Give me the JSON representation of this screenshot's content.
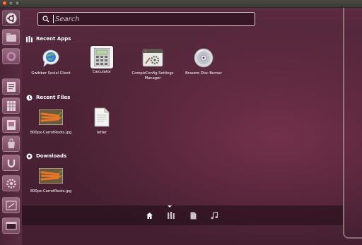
{
  "search": {
    "placeholder": "Search",
    "value": ""
  },
  "sections": {
    "recent_apps": {
      "title": "Recent Apps"
    },
    "recent_files": {
      "title": "Recent Files"
    },
    "downloads": {
      "title": "Downloads"
    }
  },
  "recent_apps": [
    {
      "label": "Gwibber Social Client",
      "icon": "gwibber-icon"
    },
    {
      "label": "Calculator",
      "icon": "calculator-icon"
    },
    {
      "label": "CompizConfig Settings Manager",
      "icon": "compizconfig-icon"
    },
    {
      "label": "Brasero Disc Burner",
      "icon": "brasero-icon"
    }
  ],
  "recent_files": [
    {
      "label": "800px-CarrotRoots.jpg",
      "icon": "image-thumbnail"
    },
    {
      "label": "letter",
      "icon": "document-icon"
    }
  ],
  "downloads": [
    {
      "label": "800px-CarrotRoots.jpg",
      "icon": "image-thumbnail"
    }
  ],
  "lenses": [
    {
      "name": "home-lens",
      "active": true
    },
    {
      "name": "applications-lens",
      "active": false
    },
    {
      "name": "files-lens",
      "active": false
    },
    {
      "name": "music-lens",
      "active": false
    }
  ],
  "colors": {
    "accent": "#dd4814",
    "dash_background": "#4a2234",
    "launcher_background": "#5a2b42",
    "text": "#ffffff"
  }
}
